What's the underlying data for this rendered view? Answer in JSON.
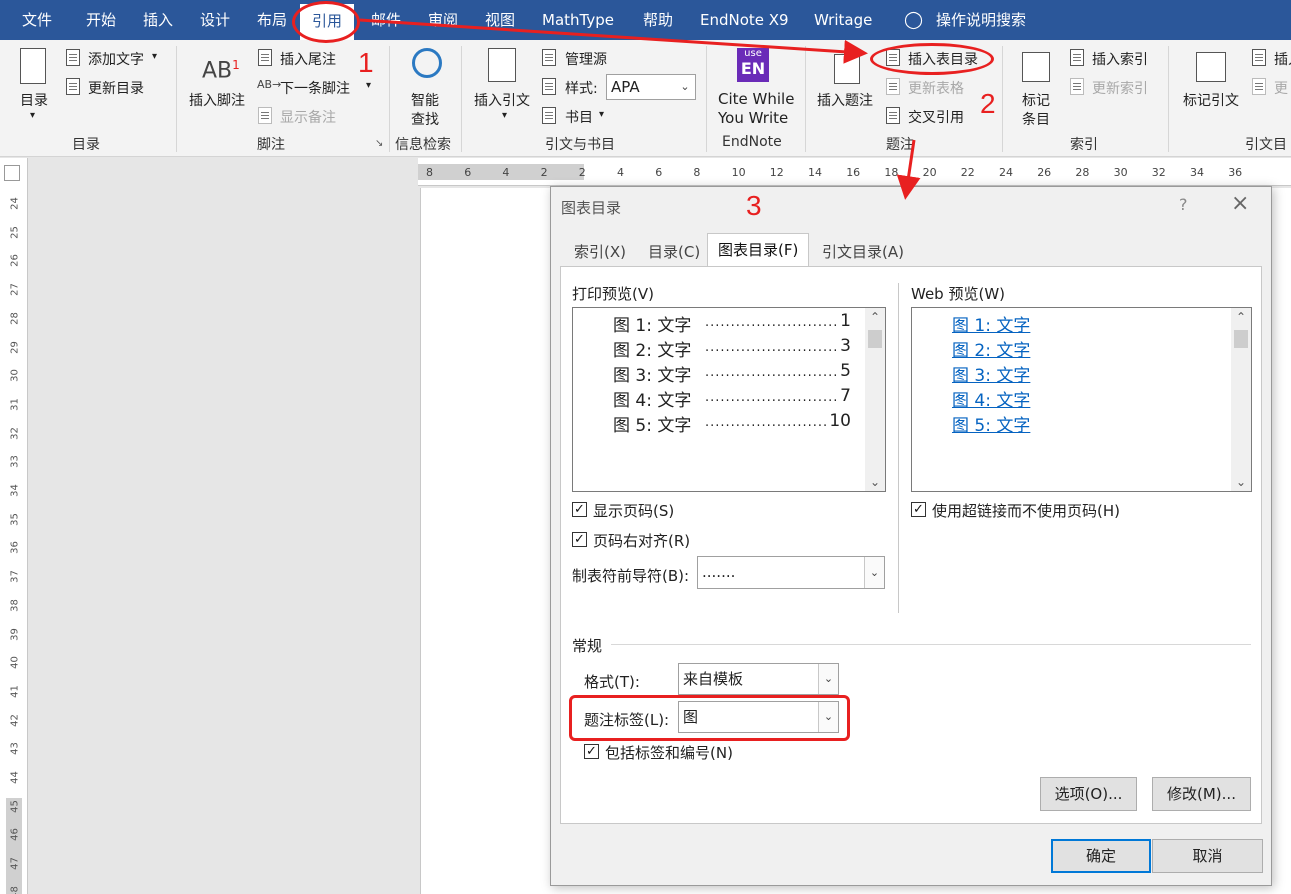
{
  "ribbon_tabs": [
    "文件",
    "开始",
    "插入",
    "设计",
    "布局",
    "引用",
    "邮件",
    "审阅",
    "视图",
    "MathType",
    "帮助",
    "EndNote X9",
    "Writage",
    "操作说明搜索"
  ],
  "active_tab": "引用",
  "ribbon": {
    "toc_group": {
      "toc_button": "目录",
      "add_text": "添加文字",
      "update_toc": "更新目录",
      "label": "目录"
    },
    "footnote_group": {
      "insert_footnote": "插入脚注",
      "insert_endnote": "插入尾注",
      "next_footnote": "下一条脚注",
      "show_notes": "显示备注",
      "label": "脚注"
    },
    "research_group": {
      "smart_lookup_1": "智能",
      "smart_lookup_2": "查找",
      "label": "信息检索"
    },
    "citation_group": {
      "insert_citation": "插入引文",
      "manage_sources": "管理源",
      "style_label": "样式:",
      "style_value": "APA",
      "bibliography": "书目",
      "label": "引文与书目"
    },
    "endnote_group": {
      "cwyw_1": "Cite While",
      "cwyw_2": "You Write",
      "label": "EndNote",
      "logo_top": "use",
      "logo_bottom": "EN"
    },
    "caption_group": {
      "insert_caption": "插入题注",
      "insert_tof": "插入表目录",
      "update_table": "更新表格",
      "cross_ref": "交叉引用",
      "label": "题注"
    },
    "index_group": {
      "mark_entry_1": "标记",
      "mark_entry_2": "条目",
      "insert_index": "插入索引",
      "update_index": "更新索引",
      "label": "索引"
    },
    "toa_group": {
      "mark_citation": "标记引文",
      "insert_toa": "插入",
      "update_toa": "更",
      "label": "引文目"
    }
  },
  "annotations": [
    "1",
    "2",
    "3"
  ],
  "vruler_numbers": [
    "24",
    "25",
    "26",
    "27",
    "28",
    "29",
    "30",
    "31",
    "32",
    "33",
    "34",
    "35",
    "36",
    "37",
    "38",
    "39",
    "40",
    "41",
    "42",
    "43",
    "44",
    "45",
    "46",
    "47",
    "48"
  ],
  "hruler_numbers": [
    "8",
    "6",
    "4",
    "2",
    "2",
    "4",
    "6",
    "8",
    "10",
    "12",
    "14",
    "16",
    "18",
    "20",
    "22",
    "24",
    "26",
    "28",
    "30",
    "32",
    "34",
    "36"
  ],
  "dialog": {
    "title": "图表目录",
    "help": "?",
    "tabs": [
      "索引(X)",
      "目录(C)",
      "图表目录(F)",
      "引文目录(A)"
    ],
    "active_tab": "图表目录(F)",
    "print_preview_label": "打印预览(V)",
    "print_preview": [
      {
        "label": "图  1:  文字",
        "page": "1"
      },
      {
        "label": "图  2:  文字",
        "page": "3"
      },
      {
        "label": "图  3:  文字",
        "page": "5"
      },
      {
        "label": "图  4:  文字",
        "page": "7"
      },
      {
        "label": "图  5:  文字",
        "page": "10"
      }
    ],
    "web_preview_label": "Web 预览(W)",
    "web_preview": [
      "图  1:  文字",
      "图  2:  文字",
      "图  3:  文字",
      "图  4:  文字",
      "图  5:  文字"
    ],
    "show_page_numbers": {
      "label": "显示页码(S)",
      "checked": true
    },
    "right_align": {
      "label": "页码右对齐(R)",
      "checked": true
    },
    "tab_leader_label": "制表符前导符(B):",
    "tab_leader_value": ".......",
    "use_hyperlinks": {
      "label": "使用超链接而不使用页码(H)",
      "checked": true
    },
    "general_label": "常规",
    "format_label": "格式(T):",
    "format_value": "来自模板",
    "caption_label_label": "题注标签(L):",
    "caption_label_value": "图",
    "include_label": {
      "label": "包括标签和编号(N)",
      "checked": true
    },
    "options_button": "选项(O)...",
    "modify_button": "修改(M)...",
    "ok_button": "确定",
    "cancel_button": "取消"
  }
}
